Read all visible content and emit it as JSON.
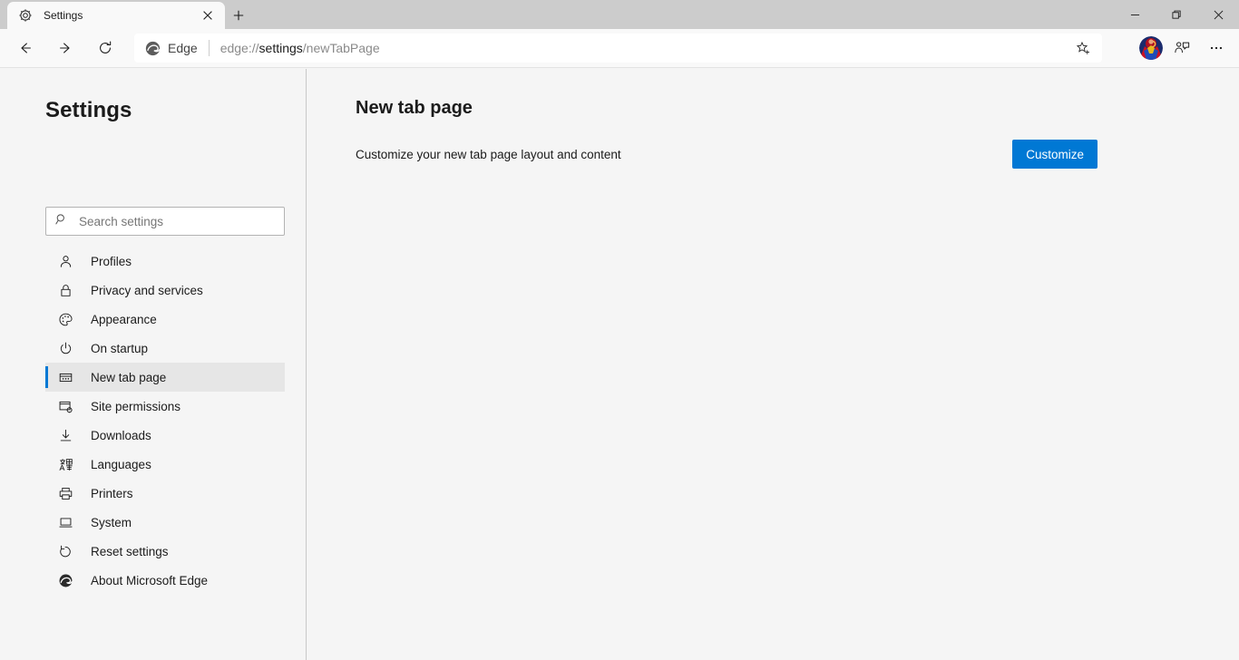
{
  "window": {
    "controls": [
      {
        "name": "minimize",
        "glyph": "minimize-icon"
      },
      {
        "name": "restore",
        "glyph": "restore-icon"
      },
      {
        "name": "close",
        "glyph": "close-icon"
      }
    ]
  },
  "tabstrip": {
    "tabs": [
      {
        "title": "Settings",
        "favicon": "gear-icon",
        "active": true,
        "close_label": "Close tab"
      }
    ],
    "new_tab_label": "New tab"
  },
  "toolbar": {
    "back_label": "Back",
    "forward_label": "Forward",
    "refresh_label": "Refresh",
    "omnibox": {
      "brand": "Edge",
      "brand_icon": "edge-logo-icon",
      "url_scheme": "edge://",
      "url_host": "settings",
      "url_path": "/newTabPage",
      "url_full": "edge://settings/newTabPage",
      "favorite_label": "Add this page to favorites"
    },
    "collections_label": "Collections",
    "more_label": "Settings and more",
    "profile_label": "Profile"
  },
  "sidebar": {
    "heading": "Settings",
    "search": {
      "placeholder": "Search settings",
      "value": "",
      "icon": "search-icon"
    },
    "items": [
      {
        "label": "Profiles",
        "icon": "person-icon",
        "selected": false
      },
      {
        "label": "Privacy and services",
        "icon": "lock-icon",
        "selected": false
      },
      {
        "label": "Appearance",
        "icon": "palette-icon",
        "selected": false
      },
      {
        "label": "On startup",
        "icon": "power-icon",
        "selected": false
      },
      {
        "label": "New tab page",
        "icon": "newtab-icon",
        "selected": true
      },
      {
        "label": "Site permissions",
        "icon": "site-permissions-icon",
        "selected": false
      },
      {
        "label": "Downloads",
        "icon": "download-arrow-icon",
        "selected": false
      },
      {
        "label": "Languages",
        "icon": "languages-icon",
        "selected": false
      },
      {
        "label": "Printers",
        "icon": "printer-icon",
        "selected": false
      },
      {
        "label": "System",
        "icon": "laptop-icon",
        "selected": false
      },
      {
        "label": "Reset settings",
        "icon": "reset-circular-arrow-icon",
        "selected": false
      },
      {
        "label": "About Microsoft Edge",
        "icon": "edge-logo-icon",
        "selected": false
      }
    ]
  },
  "main": {
    "title": "New tab page",
    "rows": [
      {
        "description": "Customize your new tab page layout and content",
        "button_label": "Customize"
      }
    ]
  },
  "colors": {
    "accent": "#0078d4",
    "titlebar_bg": "#cccccc",
    "toolbar_bg": "#f9f9f9",
    "page_bg": "#f5f5f5",
    "selected_bg": "#e6e6e6",
    "text": "#1b1b1b"
  }
}
